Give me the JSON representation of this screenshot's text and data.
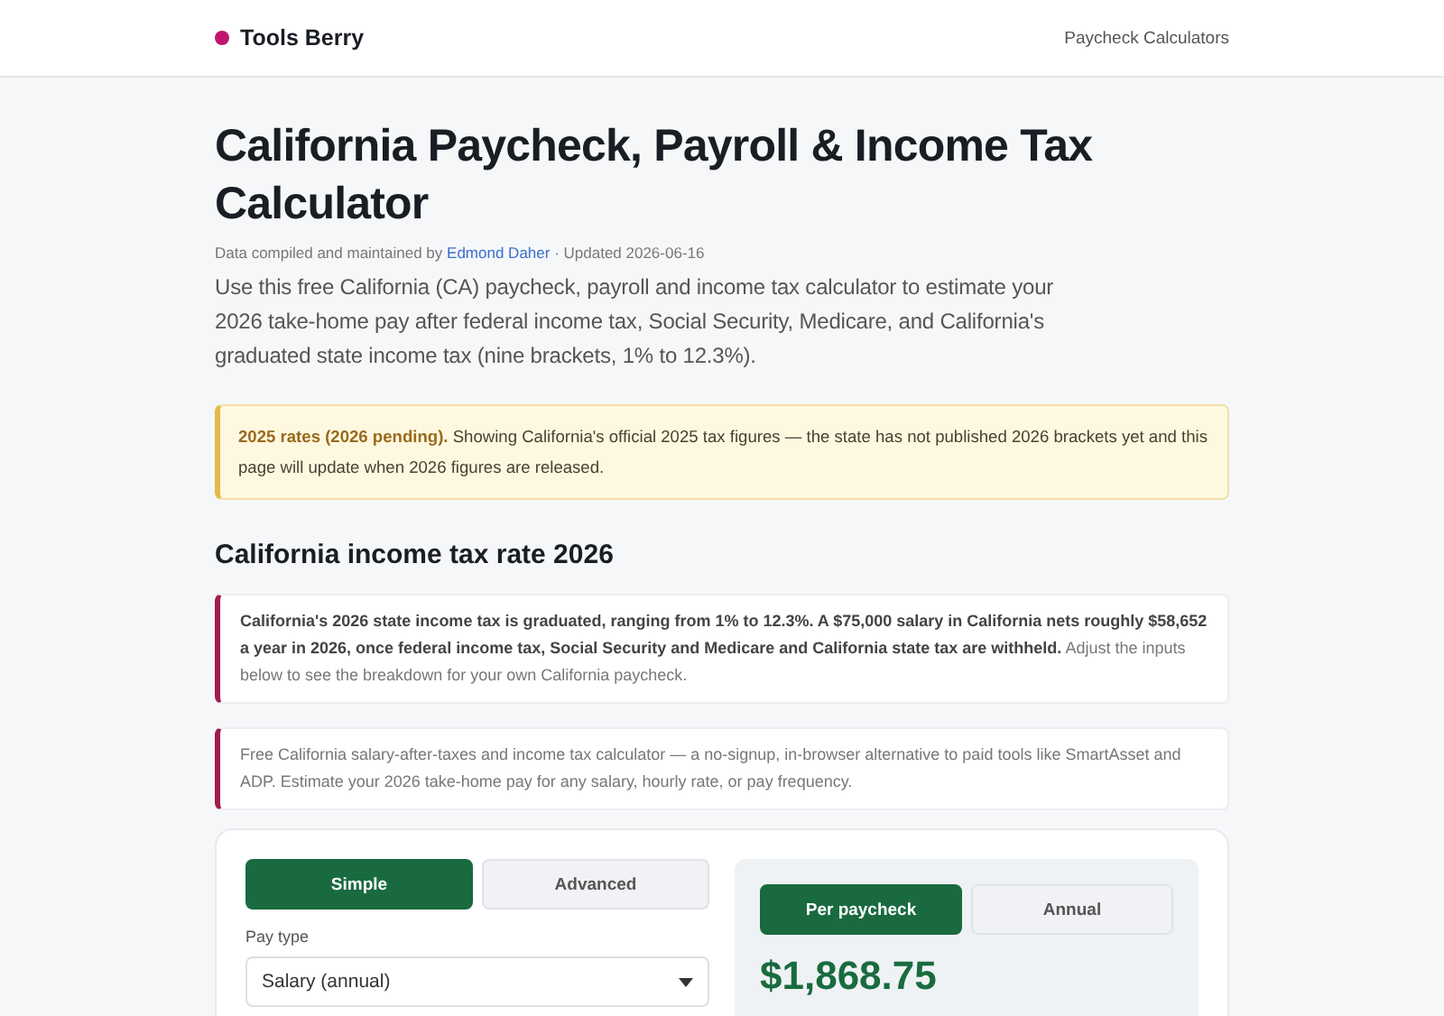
{
  "header": {
    "brand": "Tools Berry",
    "nav": [
      {
        "label": "Paycheck Calculators"
      }
    ]
  },
  "title": "California Paycheck, Payroll & Income Tax Calculator",
  "meta": {
    "before": "Data compiled and maintained by",
    "author": "Edmond Daher",
    "after": "· Updated 2026-06-16"
  },
  "intro": "Use this free California (CA) paycheck, payroll and income tax calculator to estimate your 2026 take-home pay after federal income tax, Social Security, Medicare, and California's graduated state income tax (nine brackets, 1% to 12.3%).",
  "notice": "**2025 rates (2026 pending).** Showing California's official 2025 tax figures — the state has not published 2026 brackets yet and this page will update when 2026 figures are released.",
  "section_heading": "California income tax rate 2026",
  "callouts": [
    {
      "text": "**California's 2026 state income tax is graduated, ranging from 1% to 12.3%. A $75,000 salary in California nets roughly $58,652 a year in 2026, once federal income tax, Social Security and Medicare and California state tax are withheld.** Adjust the inputs below to see the breakdown for your own California paycheck."
    },
    {
      "text": "Free California salary-after-taxes and income tax calculator — a no-signup, in-browser alternative to paid tools like SmartAsset and ADP. Estimate your 2026 take-home pay for any salary, hourly rate, or pay frequency."
    }
  ],
  "calculator": {
    "mode_tabs": [
      {
        "label": "Simple",
        "selected": true
      },
      {
        "label": "Advanced",
        "selected": false
      }
    ],
    "pay_type": {
      "label": "Pay type",
      "value": "Salary (annual)"
    },
    "period_tabs": [
      {
        "label": "Per paycheck",
        "selected": true
      },
      {
        "label": "Annual",
        "selected": false
      }
    ],
    "result": "$1,868.75"
  }
}
